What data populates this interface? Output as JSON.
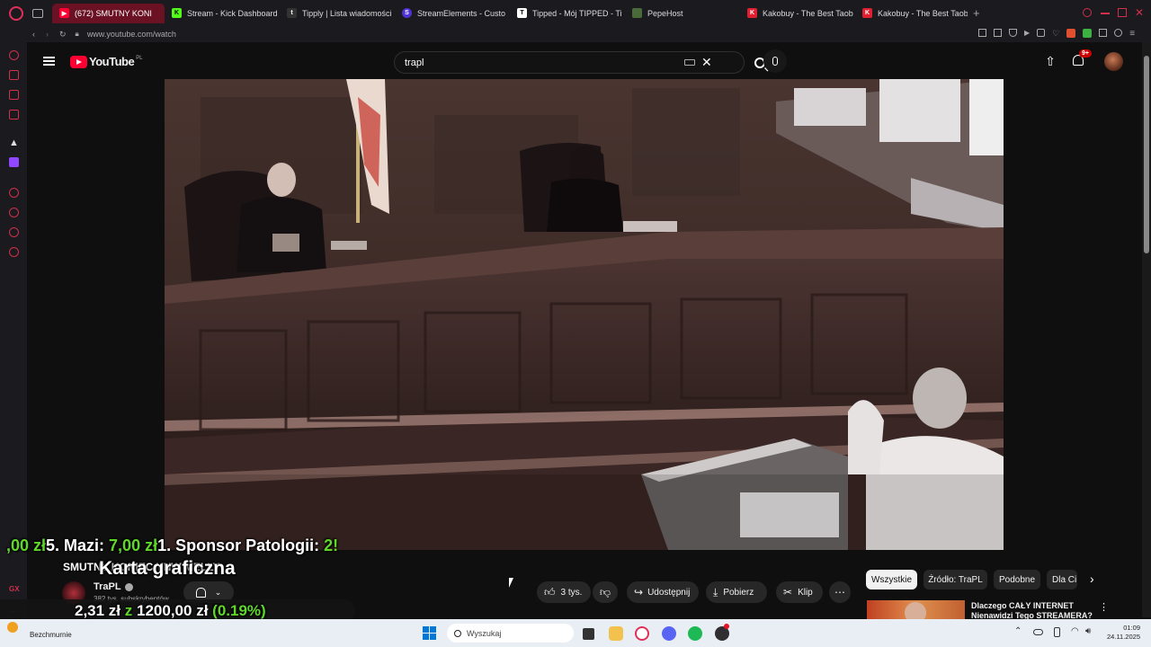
{
  "browser": {
    "tabs": [
      {
        "label": "(672) SMUTNY KONI",
        "active": true
      },
      {
        "label": "Stream - Kick Dashboard"
      },
      {
        "label": "Tipply | Lista wiadomości"
      },
      {
        "label": "StreamElements - Custo"
      },
      {
        "label": "Tipped - Mój TIPPED - Ti"
      },
      {
        "label": "PepeHost"
      },
      {
        "label": "Kakobuy - The Best Taob"
      },
      {
        "label": "Kakobuy - The Best Taob"
      }
    ],
    "url": "www.youtube.com/watch"
  },
  "youtube": {
    "logo_text": "YouTube",
    "region": "PL",
    "search_value": "trapl",
    "notifications_badge": "9+",
    "channel_name": "TraPL",
    "subscribers": "382 tys. subskrybentów",
    "likes": "3 tys.",
    "share_label": "Udostępnij",
    "download_label": "Pobierz",
    "clip_label": "Klip",
    "chips": [
      "Wszystkie",
      "Źródło: TraPL",
      "Podobne",
      "Dla Ci"
    ],
    "recommended_title_line1": "Dlaczego CAŁY INTERNET",
    "recommended_title_line2": "Nienawidzi Tego STREAMERA?"
  },
  "overlay": {
    "ticker_prefix": ",00 zł",
    "ticker_item1_name": "5. Mazi: ",
    "ticker_item1_amount": "7,00 zł",
    "ticker_item2_name": "1. Sponsor Patologii: ",
    "ticker_item2_amount": "2!",
    "title_small": "SMUTNY KONIEC YNW MELLY",
    "goal_label": "Karta graficzna",
    "goal_current": "2,31 zł",
    "goal_of": "z",
    "goal_target": "1200,00 zł",
    "goal_percent": "(0.19%)",
    "bottom_status": "Bezchmurnie"
  },
  "taskbar": {
    "search_placeholder": "Wyszukaj",
    "time": "01:09",
    "date": "24.11.2025"
  },
  "colors": {
    "accent_green": "#5fd82a",
    "yt_red": "#ff0033",
    "gx_red": "#e0305a"
  }
}
